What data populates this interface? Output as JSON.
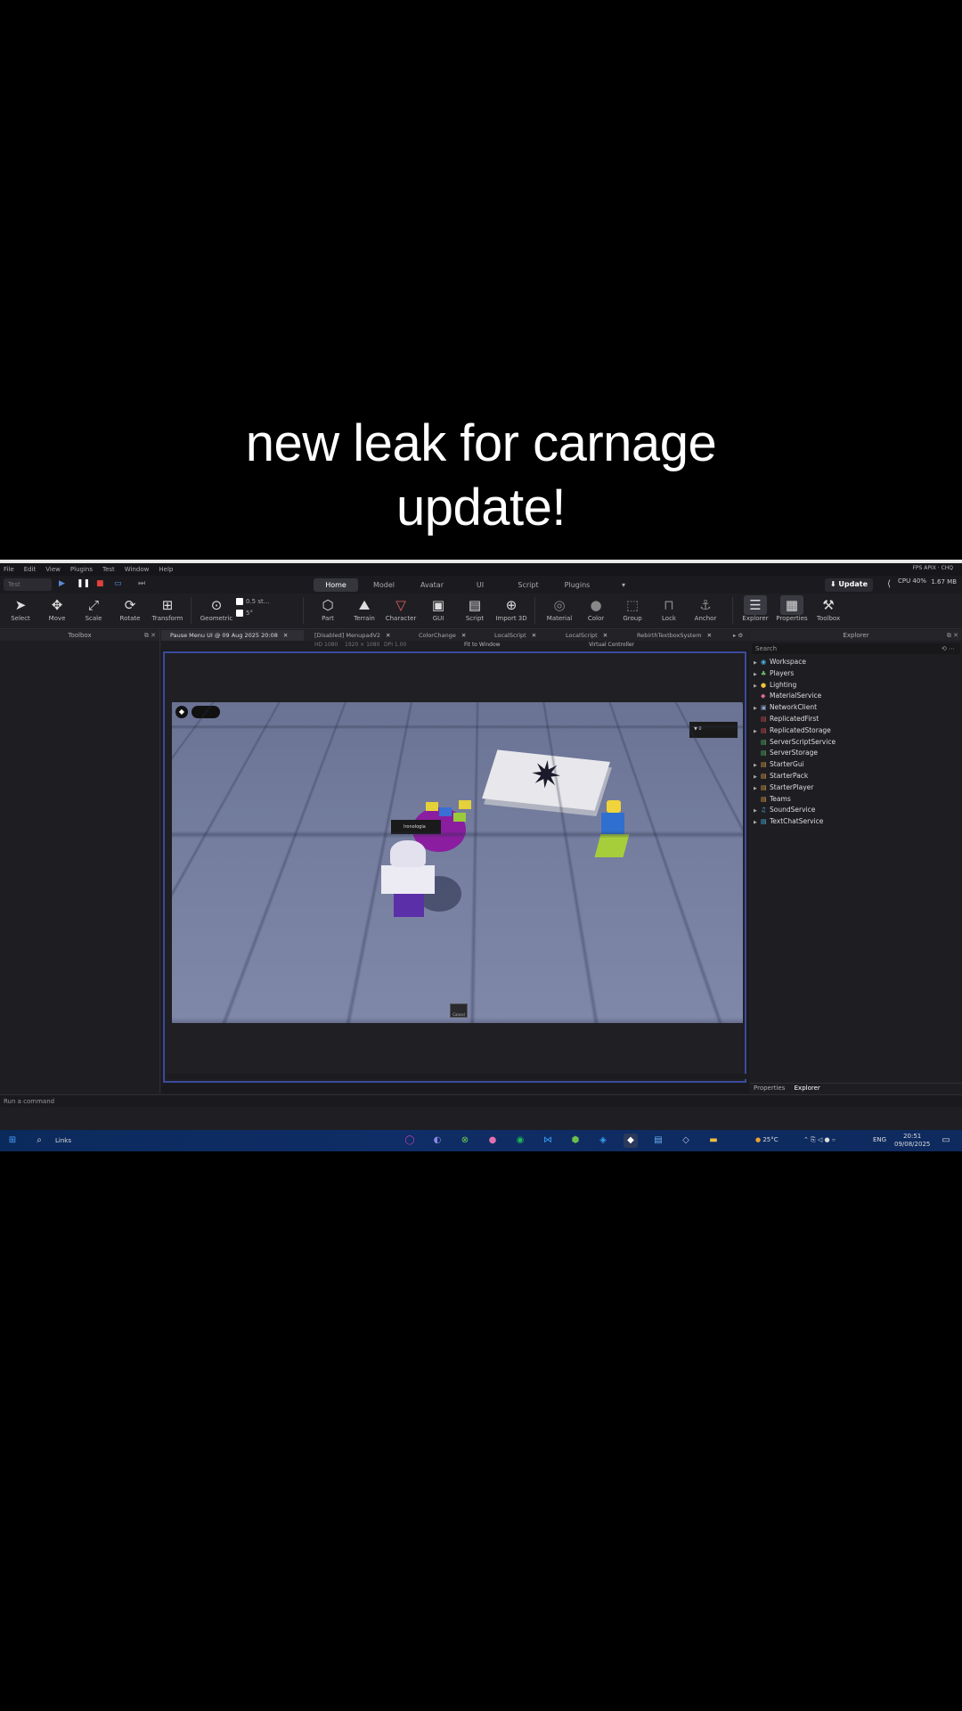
{
  "caption": {
    "line1": "new leak for carnage",
    "line2": "update!"
  },
  "menubar": {
    "items": [
      "File",
      "Edit",
      "View",
      "Plugins",
      "Test",
      "Window",
      "Help"
    ],
    "right": "FPS  APIX  ·  CHQ"
  },
  "top": {
    "test_select": "Test",
    "mode_tabs": [
      "Home",
      "Model",
      "Avatar",
      "UI",
      "Script",
      "Plugins"
    ],
    "active_tab": "Home",
    "update_label": "Update",
    "cpu": "CPU 40%",
    "mem": "1.67 MB"
  },
  "tools": {
    "select": "Select",
    "move": "Move",
    "scale": "Scale",
    "rotate": "Rotate",
    "transform": "Transform",
    "geometric": "Geometric",
    "snap_move": "0.5 st...",
    "snap_rotate": "5°",
    "part": "Part",
    "terrain": "Terrain",
    "character": "Character",
    "gui": "GUI",
    "script": "Script",
    "import3d": "Import 3D",
    "material": "Material",
    "color": "Color",
    "group": "Group",
    "lock": "Lock",
    "anchor": "Anchor",
    "explorer": "Explorer",
    "properties": "Properties",
    "toolbox": "Toolbox"
  },
  "left_pane": {
    "title": "Toolbox"
  },
  "doc_tabs": [
    "Pause Menu UI @ 09 Aug 2025 20:08",
    "[Disabled] MenupadV2",
    "ColorChange",
    "LocalScript",
    "LocalScript",
    "RebirthTextboxSystem"
  ],
  "view_bar": {
    "device": "HD 1080",
    "resolution": "1920 × 1080",
    "scale": "DPI 1.00",
    "fit": "Fit to Window",
    "controller": "Virtual Controller"
  },
  "scene": {
    "nametag": "Ironologia",
    "corner_tag": "▼ 0",
    "pad_label": "Cancel"
  },
  "explorer": {
    "title": "Explorer",
    "search_placeholder": "Search",
    "nodes": [
      {
        "label": "Workspace",
        "arrow": true,
        "icon": "◉",
        "color": "#4fb3e8"
      },
      {
        "label": "Players",
        "arrow": true,
        "icon": "♣",
        "color": "#6cbf6c"
      },
      {
        "label": "Lighting",
        "arrow": true,
        "icon": "●",
        "color": "#f0c33c"
      },
      {
        "label": "MaterialService",
        "arrow": false,
        "icon": "◆",
        "color": "#e06a8a"
      },
      {
        "label": "NetworkClient",
        "arrow": true,
        "icon": "▣",
        "color": "#8aa0c8"
      },
      {
        "label": "ReplicatedFirst",
        "arrow": false,
        "icon": "▤",
        "color": "#d14f4f"
      },
      {
        "label": "ReplicatedStorage",
        "arrow": true,
        "icon": "▤",
        "color": "#d14f4f"
      },
      {
        "label": "ServerScriptService",
        "arrow": false,
        "icon": "▤",
        "color": "#56b86a"
      },
      {
        "label": "ServerStorage",
        "arrow": false,
        "icon": "▤",
        "color": "#56b86a"
      },
      {
        "label": "StarterGui",
        "arrow": true,
        "icon": "▤",
        "color": "#e0a24a"
      },
      {
        "label": "StarterPack",
        "arrow": true,
        "icon": "▤",
        "color": "#e0a24a"
      },
      {
        "label": "StarterPlayer",
        "arrow": true,
        "icon": "▤",
        "color": "#e0a24a"
      },
      {
        "label": "Teams",
        "arrow": false,
        "icon": "▤",
        "color": "#e0a24a"
      },
      {
        "label": "SoundService",
        "arrow": true,
        "icon": "♫",
        "color": "#4fb3e8"
      },
      {
        "label": "TextChatService",
        "arrow": true,
        "icon": "▤",
        "color": "#4fb3e8"
      }
    ],
    "bottom_tabs": [
      "Properties",
      "Explorer"
    ]
  },
  "command_bar": {
    "placeholder": "Run a command"
  },
  "taskbar": {
    "search": "Links",
    "weather": "25°C",
    "lang": "ENG",
    "time": "20:51",
    "date": "09/08/2025"
  },
  "colors": {
    "accent": "#3b4a9c",
    "background": "#1f1f23",
    "taskbar": "#0e2a5e"
  }
}
